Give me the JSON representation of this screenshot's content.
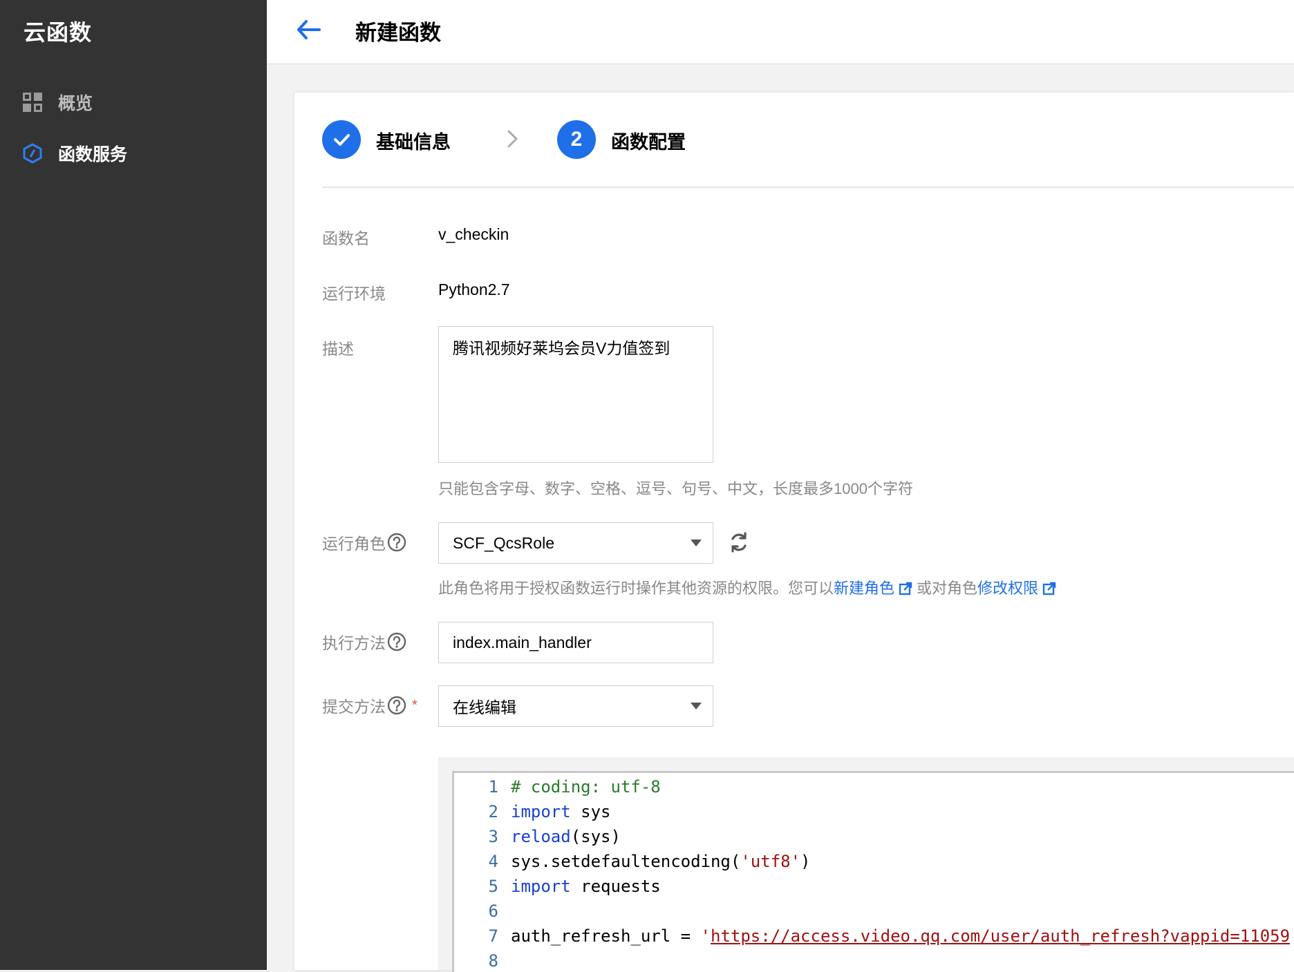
{
  "sidebar": {
    "brand": "云函数",
    "items": [
      {
        "label": "概览",
        "icon": "grid-icon"
      },
      {
        "label": "函数服务",
        "icon": "function-hexagon-icon"
      }
    ]
  },
  "header": {
    "title": "新建函数"
  },
  "steps": [
    {
      "label": "基础信息",
      "state": "done"
    },
    {
      "number": "2",
      "label": "函数配置",
      "state": "active"
    }
  ],
  "form": {
    "function_name": {
      "label": "函数名",
      "value": "v_checkin"
    },
    "runtime": {
      "label": "运行环境",
      "value": "Python2.7"
    },
    "description": {
      "label": "描述",
      "value": "腾讯视频好莱坞会员V力值签到",
      "hint": "只能包含字母、数字、空格、逗号、句号、中文，长度最多1000个字符"
    },
    "role": {
      "label": "运行角色",
      "value": "SCF_QcsRole",
      "hint_prefix": "此角色将用于授权函数运行时操作其他资源的权限。您可以",
      "link_new_role": "新建角色",
      "hint_middle": "或对角色",
      "link_modify": "修改权限"
    },
    "handler": {
      "label": "执行方法",
      "value": "index.main_handler"
    },
    "submit_method": {
      "label": "提交方法",
      "required_mark": "*",
      "value": "在线编辑"
    }
  },
  "code": {
    "lines": [
      {
        "n": "1",
        "comment": "# coding: utf-8"
      },
      {
        "n": "2",
        "kw": "import",
        "rest": " sys"
      },
      {
        "n": "3",
        "kw": "reload",
        "rest": "(sys)"
      },
      {
        "n": "4",
        "pre": "sys.setdefaultencoding(",
        "str": "'utf8'",
        "post": ")"
      },
      {
        "n": "5",
        "kw": "import",
        "rest": " requests"
      },
      {
        "n": "6"
      },
      {
        "n": "7",
        "pre": "auth_refresh_url = ",
        "q": "'",
        "url": "https://access.video.qq.com/user/auth_refresh?vappid=11059"
      },
      {
        "n": "8"
      }
    ]
  },
  "colors": {
    "sidebar_bg": "#333333",
    "accent": "#1f6fe8",
    "required": "#e54545"
  }
}
